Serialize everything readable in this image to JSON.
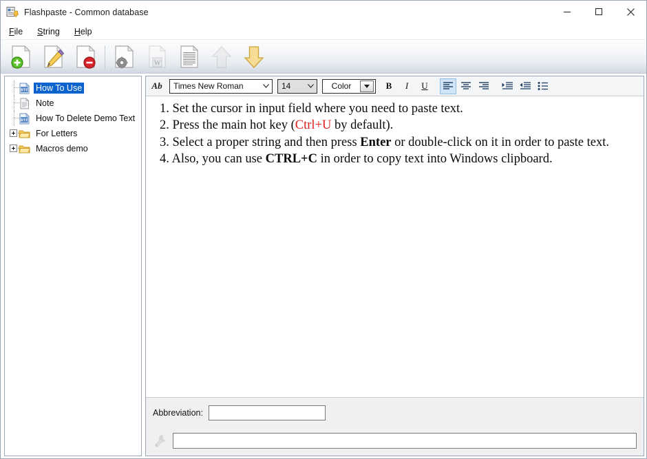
{
  "window": {
    "title": "Flashpaste - Common database",
    "app_icon": "flashpaste-document-arrow-icon",
    "controls": {
      "minimize": "minimize-button",
      "maximize": "maximize-button",
      "close": "close-button"
    }
  },
  "menubar": {
    "items": [
      {
        "label": "File",
        "accel": "F"
      },
      {
        "label": "String",
        "accel": "S"
      },
      {
        "label": "Help",
        "accel": "H"
      }
    ]
  },
  "toolbar": {
    "buttons": [
      {
        "name": "new-string-button",
        "icon": "document-add-icon",
        "enabled": true
      },
      {
        "name": "edit-string-button",
        "icon": "document-pencil-icon",
        "enabled": true
      },
      {
        "name": "delete-string-button",
        "icon": "document-delete-icon",
        "enabled": true
      },
      {
        "name": "settings-button",
        "icon": "document-gear-icon",
        "enabled": true
      },
      {
        "name": "import-word-button",
        "icon": "document-word-icon",
        "enabled": false
      },
      {
        "name": "import-text-button",
        "icon": "document-text-icon",
        "enabled": true
      },
      {
        "name": "move-up-button",
        "icon": "arrow-up-icon",
        "enabled": false
      },
      {
        "name": "move-down-button",
        "icon": "arrow-down-icon",
        "enabled": true
      }
    ]
  },
  "tree": {
    "items": [
      {
        "label": "How To Use",
        "icon": "rtf-document-icon",
        "type": "item",
        "selected": true,
        "expandable": false
      },
      {
        "label": "Note",
        "icon": "text-document-icon",
        "type": "item",
        "selected": false,
        "expandable": false
      },
      {
        "label": "How To Delete Demo Text",
        "icon": "rtf-document-icon",
        "type": "item",
        "selected": false,
        "expandable": false
      },
      {
        "label": "For Letters",
        "icon": "folder-icon",
        "type": "folder",
        "selected": false,
        "expandable": true
      },
      {
        "label": "Macros demo",
        "icon": "folder-icon",
        "type": "folder",
        "selected": false,
        "expandable": true
      }
    ]
  },
  "format_toolbar": {
    "ab_label": "Ab",
    "font_name": "Times New Roman",
    "font_size": "14",
    "color_label": "Color",
    "bold_label": "B",
    "italic_label": "I",
    "underline_label": "U",
    "align_left": "align-left",
    "align_center": "align-center",
    "align_right": "align-right",
    "indent_increase": "indent-increase",
    "indent_decrease": "indent-decrease",
    "bullet_list": "bullet-list",
    "active_alignment": "align-left"
  },
  "editor": {
    "line1": "1. Set the cursor in input field where you need to paste text.",
    "line2_a": "2. Press the main hot key (",
    "line2_hotkey": "Ctrl+U",
    "line2_b": " by default).",
    "line3_a": "3. Select a proper string and then press ",
    "line3_bold": "Enter",
    "line3_b": " or double-click on it in order to paste text.",
    "line4_a": "4. Also, you can use ",
    "line4_bold": "CTRL+C",
    "line4_b": " in order to copy text into Windows clipboard."
  },
  "bottom": {
    "abbreviation_label": "Abbreviation:",
    "abbreviation_value": "",
    "abbreviation_placeholder": "",
    "macro_icon": "wrench-tool-icon",
    "macro_value": "",
    "macro_placeholder": ""
  },
  "colors": {
    "selection_blue": "#0b63ce",
    "hotkey_red": "#e01b1b",
    "toolbar_top": "#fdfdfe",
    "toolbar_bottom": "#b9c3cf",
    "panel_gray": "#f0f0f0",
    "border_gray": "#9ba7b4",
    "arrow_yellow": "#f5d78a"
  }
}
